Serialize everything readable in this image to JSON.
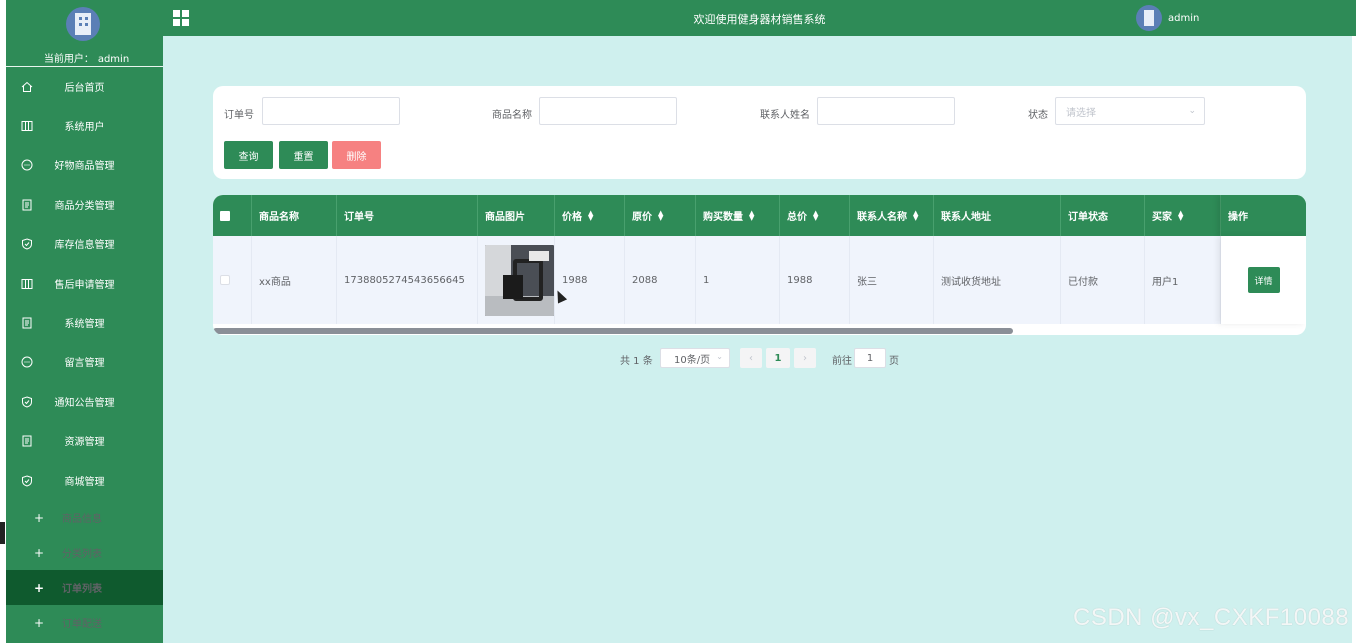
{
  "sidebar": {
    "current_user_label": "当前用户：",
    "current_user": "admin",
    "items": [
      {
        "label": "后台首页",
        "icon": "home-icon"
      },
      {
        "label": "系统用户",
        "icon": "columns-icon"
      },
      {
        "label": "好物商品管理",
        "icon": "chat-icon"
      },
      {
        "label": "商品分类管理",
        "icon": "document-icon"
      },
      {
        "label": "库存信息管理",
        "icon": "shield-check-icon"
      },
      {
        "label": "售后申请管理",
        "icon": "columns-icon"
      },
      {
        "label": "系统管理",
        "icon": "document-icon"
      },
      {
        "label": "留言管理",
        "icon": "chat-icon"
      },
      {
        "label": "通知公告管理",
        "icon": "shield-check-icon"
      },
      {
        "label": "资源管理",
        "icon": "document-icon"
      },
      {
        "label": "商城管理",
        "icon": "shield-check-icon"
      }
    ],
    "sub_items": [
      {
        "label": "商品信息",
        "active": false
      },
      {
        "label": "分类列表",
        "active": false
      },
      {
        "label": "订单列表",
        "active": true
      },
      {
        "label": "订单配送",
        "active": false
      }
    ]
  },
  "topbar": {
    "title": "欢迎使用健身器材销售系统",
    "user": "admin"
  },
  "search": {
    "order_no_label": "订单号",
    "order_no_value": "",
    "product_name_label": "商品名称",
    "product_name_value": "",
    "contact_name_label": "联系人姓名",
    "contact_name_value": "",
    "status_label": "状态",
    "status_placeholder": "请选择",
    "query_button": "查询",
    "reset_button": "重置",
    "delete_button": "删除"
  },
  "table": {
    "headers": {
      "product_name": "商品名称",
      "order_no": "订单号",
      "product_image": "商品图片",
      "price": "价格",
      "original_price": "原价",
      "quantity": "购买数量",
      "total": "总价",
      "contact_name": "联系人名称",
      "contact_address": "联系人地址",
      "order_status": "订单状态",
      "buyer": "买家",
      "actions": "操作"
    },
    "rows": [
      {
        "product_name": "xx商品",
        "order_no": "1738805274543656645",
        "price": "1988",
        "original_price": "2088",
        "quantity": "1",
        "total": "1988",
        "contact_name": "张三",
        "contact_address": "测试收货地址",
        "order_status": "已付款",
        "buyer": "用户1",
        "detail_button": "详情"
      }
    ]
  },
  "pagination": {
    "total_text": "共 1 条",
    "page_size": "10条/页",
    "current_page": "1",
    "goto_label": "前往",
    "goto_value": "1",
    "page_suffix": "页"
  },
  "watermark": "CSDN @vx_CXKF10088",
  "colors": {
    "primary": "#2e8b57",
    "background": "#cff0ee",
    "danger": "#f56c6c"
  }
}
